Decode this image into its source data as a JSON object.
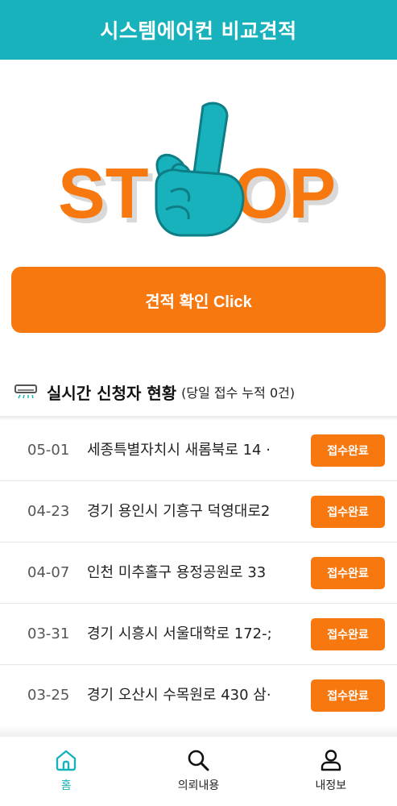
{
  "app": {
    "title": "시스템에어컨 비교견적"
  },
  "logo": {
    "left": "ST",
    "right": "OP"
  },
  "cta": {
    "label": "견적 확인 Click"
  },
  "section": {
    "title": "실시간 신청자 현황",
    "subtitle": "(당일 접수 누적 0건)"
  },
  "requests": [
    {
      "date": "05-01",
      "address": "세종특별자치시 새롬북로 14 ·",
      "status": "접수완료"
    },
    {
      "date": "04-23",
      "address": "경기 용인시 기흥구 덕영대로2",
      "status": "접수완료"
    },
    {
      "date": "04-07",
      "address": "인천 미추홀구 용정공원로 33",
      "status": "접수완료"
    },
    {
      "date": "03-31",
      "address": "경기 시흥시 서울대학로 172-;",
      "status": "접수완료"
    },
    {
      "date": "03-25",
      "address": "경기 오산시 수목원로 430 삼·",
      "status": "접수완료"
    }
  ],
  "nav": {
    "home": "홈",
    "requests": "의뢰내용",
    "profile": "내정보"
  },
  "colors": {
    "primary": "#17b2bb",
    "accent": "#f6780f"
  }
}
